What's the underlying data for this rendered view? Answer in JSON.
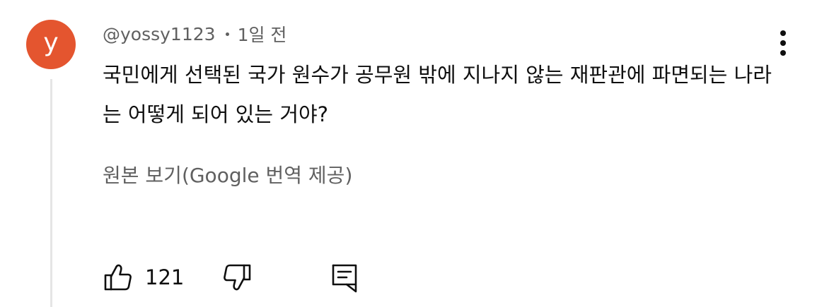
{
  "comment": {
    "avatar_letter": "y",
    "avatar_color": "#e4552f",
    "author": "@yossy1123",
    "timestamp": "1일 전",
    "text": "국민에게 선택된 국가 원수가 공무원 밖에 지나지 않는 재판관에 파면되는 나라는 어떻게 되어 있는 거야?",
    "translation_link": "원본 보기(Google 번역 제공)"
  },
  "actions": {
    "like_count": "121",
    "like_icon": "thumbs-up-icon",
    "dislike_icon": "thumbs-down-icon",
    "reply_icon": "reply-icon",
    "more_icon": "more-vertical-icon"
  }
}
